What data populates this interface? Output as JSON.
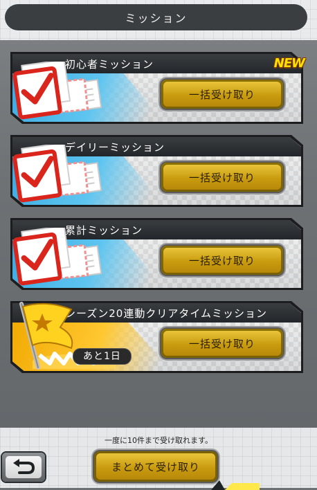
{
  "header": {
    "title": "ミッション"
  },
  "missions": [
    {
      "title": "初心者ミッション",
      "button_label": "一括受け取り",
      "badge": "NEW",
      "icon": "mail-check-icon",
      "theme": "blue"
    },
    {
      "title": "デイリーミッション",
      "button_label": "一括受け取り",
      "icon": "mail-check-icon",
      "theme": "blue"
    },
    {
      "title": "累計ミッション",
      "button_label": "一括受け取り",
      "icon": "mail-check-icon",
      "theme": "blue"
    },
    {
      "title": "シーズン20連動クリアタイムミッション",
      "button_label": "一括受け取り",
      "remaining": "あと1日",
      "icon": "flag-icon",
      "theme": "gold"
    }
  ],
  "footer": {
    "note": "一度に10件まで受け取れます。",
    "claim_all_label": "まとめて受け取り",
    "back_icon": "back-arrow-icon"
  },
  "colors": {
    "accent_gold": "#d6a81c",
    "accent_blue": "#39a9e0",
    "dark": "#23262a"
  }
}
